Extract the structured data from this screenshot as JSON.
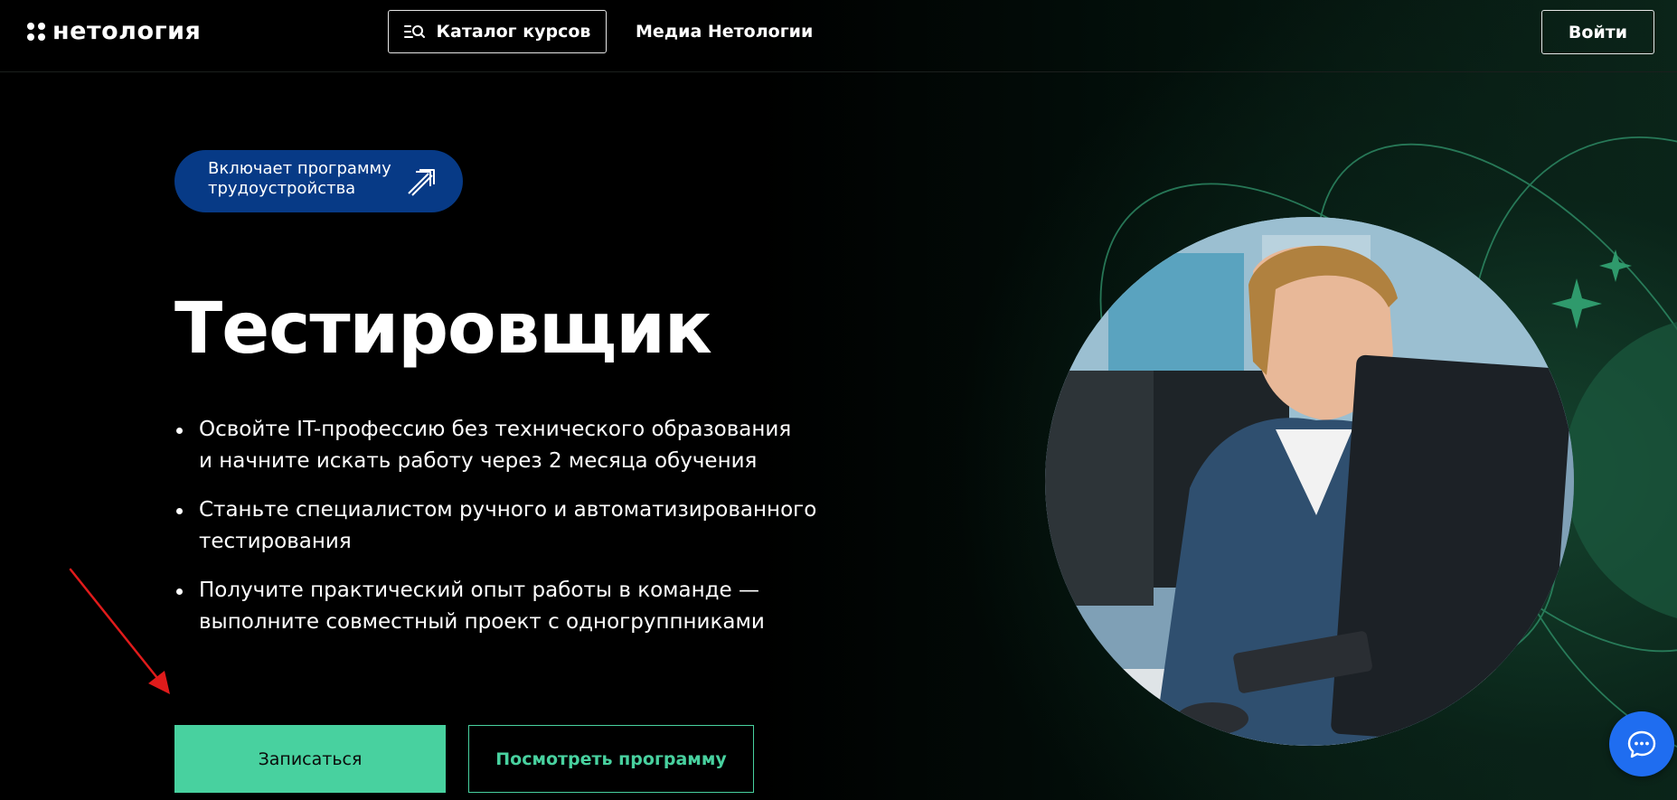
{
  "header": {
    "logo_text": "нетология",
    "catalog_label": "Каталог курсов",
    "media_label": "Медиа Нетологии",
    "login_label": "Войти"
  },
  "hero": {
    "badge_lines": [
      "Включает программу",
      "трудоустройства"
    ],
    "title": "Тестировщик",
    "bullets": [
      [
        "Освойте IT-профессию без технического образования",
        "и начните искать работу через 2 месяца обучения"
      ],
      [
        "Станьте специалистом ручного и автоматизированного",
        "тестирования"
      ],
      [
        "Получите практический опыт работы в команде —",
        "выполните совместный проект с одногруппниками"
      ]
    ],
    "enroll_label": "Записаться",
    "program_label": "Посмотреть программу"
  },
  "icons": {
    "logo": "logo-icon",
    "catalog": "catalog-search-icon",
    "badge": "arrow-up-right-icon",
    "chat": "chat-bubble-icon",
    "annotation": "red-arrow-icon"
  },
  "colors": {
    "accent_green": "#48d19f",
    "badge_blue": "#073a86",
    "chat_blue": "#1f6df0",
    "annotation_red": "#e01b1b",
    "background": "#000000"
  }
}
